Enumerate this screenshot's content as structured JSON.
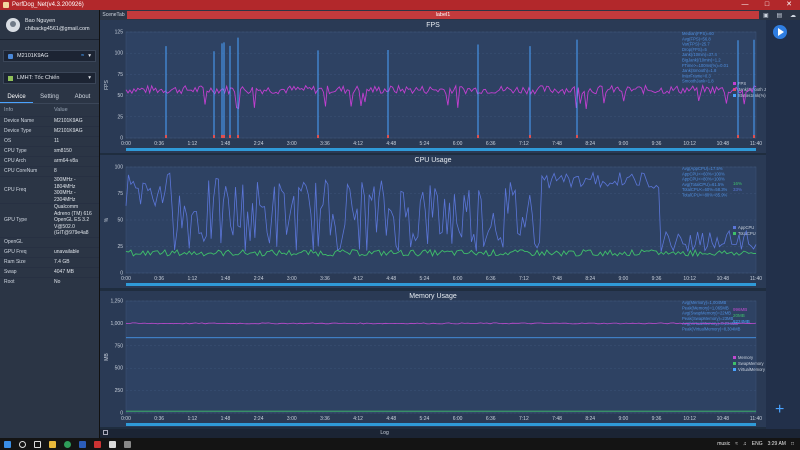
{
  "window": {
    "title": "PerfDog_Net(v4.3.200926)"
  },
  "user": {
    "name": "Bao Nguyen",
    "email": "chibackg4561@gmail.com"
  },
  "device_select": {
    "value": "M2101K9AG"
  },
  "app_select": {
    "value": "LMHT: Tốc Chiến"
  },
  "tabs": [
    "Device",
    "Setting",
    "About"
  ],
  "info": {
    "header": [
      "Info",
      "Value"
    ],
    "rows": [
      {
        "k": "Device Name",
        "v": "M2101K9AG"
      },
      {
        "k": "Device Type",
        "v": "M2101K9AG"
      },
      {
        "k": "OS",
        "v": "11"
      },
      {
        "k": "CPU Type",
        "v": "sm8150"
      },
      {
        "k": "CPU Arch",
        "v": "arm64-v8a"
      },
      {
        "k": "CPU CoreNum",
        "v": "8"
      },
      {
        "k": "CPU Freq",
        "v": "300MHz - 1804MHz\n300MHz - 2304MHz"
      },
      {
        "k": "GPU Type",
        "v": "Qualcomm Adreno (TM) 616\nOpenGL ES 3.2 V@502.0 (GIT@979e4a8"
      },
      {
        "k": "OpenGL",
        "v": ""
      },
      {
        "k": "GPU Freq",
        "v": "unavailable"
      },
      {
        "k": "Ram Size",
        "v": "7.4 GB"
      },
      {
        "k": "Swap",
        "v": "4047 MB"
      },
      {
        "k": "Root",
        "v": "No"
      }
    ]
  },
  "topbar": {
    "scene_tab": "SceneTab",
    "label": "label1"
  },
  "time_ticks": [
    "0:00",
    "0:36",
    "1:12",
    "1:48",
    "2:24",
    "3:00",
    "3:36",
    "4:12",
    "4:48",
    "5:24",
    "6:00",
    "6:36",
    "7:12",
    "7:48",
    "8:24",
    "9:00",
    "9:36",
    "10:12",
    "10:48",
    "11:40"
  ],
  "fps_chart": {
    "title": "FPS",
    "ylabel": "FPS",
    "yticks": [
      "0",
      "25",
      "50",
      "75",
      "100",
      "125"
    ],
    "legend": [
      "FPS",
      "Jank(Smooth Jank)",
      "StutterJank(%)"
    ],
    "stats": [
      "Median(FPS)=60",
      "Avg(FPS)=56.8",
      "Var(FPS)=25.7",
      "Drop(FPS)=5",
      "Jank(/10min)=37.4",
      "BigJank(/10min)=1.2",
      "FTime>=100ms(%)=0.01",
      "Jank(Smooth)=1.8",
      "InterFrame=0.3",
      "SmoothJank=1.8"
    ]
  },
  "cpu_chart": {
    "title": "CPU Usage",
    "ylabel": "%",
    "yticks": [
      "0",
      "25",
      "50",
      "75",
      "100"
    ],
    "legend": [
      "AppCPU",
      "TotalCPU"
    ],
    "values_right": [
      "16%",
      "33%"
    ],
    "stats": [
      "Avg(AppCPU)=17.5%",
      "AppCPU<=60%=100%",
      "AppCPU<=80%=100%",
      "Avg(TotalCPU)=61.5%",
      "TotalCPU<=60%=58.3%",
      "TotalCPU<=80%=85.9%"
    ]
  },
  "mem_chart": {
    "title": "Memory Usage",
    "ylabel": "MB",
    "yticks": [
      "0",
      "250",
      "500",
      "750",
      "1,000",
      "1,250"
    ],
    "legend": [
      "Memory",
      "SwapMemory",
      "VirtualMemory"
    ],
    "values_right": [
      "996MB",
      "20MB",
      "8224MB"
    ],
    "stats": [
      "Avg(Memory)=1,004MB",
      "Peak(Memory)=1,065MB",
      "Avg(SwapMemory)=22MB",
      "Peak(SwapMemory)=23MB",
      "Avg(VirtualMemory)=8,224MB",
      "Peak(VirtualMemory)=8,304MB"
    ]
  },
  "log": {
    "label": "Log"
  },
  "taskbar": {
    "music": "music",
    "lang": "ENG",
    "time": "3:29 AM"
  },
  "colors": {
    "titlebar": "#b2282b",
    "fps_line": "#c23fd0",
    "cpu_line": "#5b76d8",
    "cpu_total": "#3fbf6a",
    "mem_line": "#c04ad0",
    "accent": "#2f7de1"
  }
}
